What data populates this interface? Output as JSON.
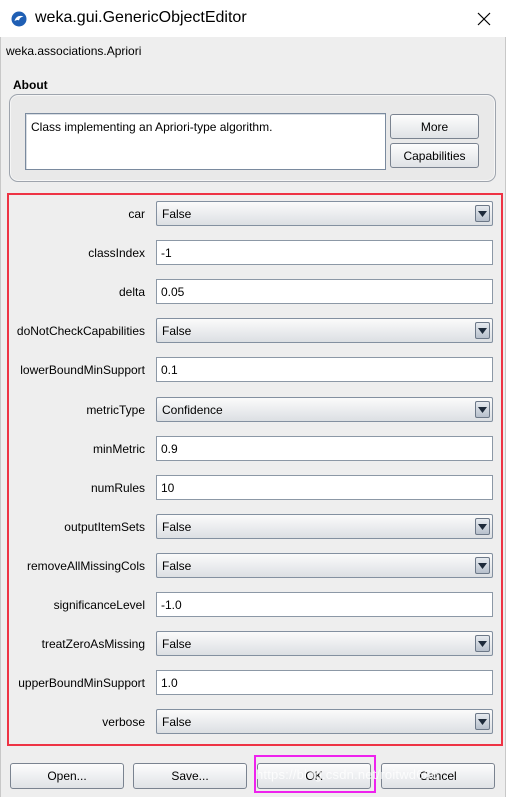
{
  "window": {
    "title": "weka.gui.GenericObjectEditor"
  },
  "editor": {
    "class_name": "weka.associations.Apriori"
  },
  "about": {
    "label": "About",
    "text": "Class implementing an Apriori-type algorithm.",
    "more_label": "More",
    "capabilities_label": "Capabilities"
  },
  "properties": [
    {
      "name": "car",
      "type": "combo",
      "value": "False"
    },
    {
      "name": "classIndex",
      "type": "text",
      "value": "-1"
    },
    {
      "name": "delta",
      "type": "text",
      "value": "0.05"
    },
    {
      "name": "doNotCheckCapabilities",
      "type": "combo",
      "value": "False"
    },
    {
      "name": "lowerBoundMinSupport",
      "type": "text",
      "value": "0.1"
    },
    {
      "name": "metricType",
      "type": "combo",
      "value": "Confidence"
    },
    {
      "name": "minMetric",
      "type": "text",
      "value": "0.9"
    },
    {
      "name": "numRules",
      "type": "text",
      "value": "10"
    },
    {
      "name": "outputItemSets",
      "type": "combo",
      "value": "False"
    },
    {
      "name": "removeAllMissingCols",
      "type": "combo",
      "value": "False"
    },
    {
      "name": "significanceLevel",
      "type": "text",
      "value": "-1.0"
    },
    {
      "name": "treatZeroAsMissing",
      "type": "combo",
      "value": "False"
    },
    {
      "name": "upperBoundMinSupport",
      "type": "text",
      "value": "1.0"
    },
    {
      "name": "verbose",
      "type": "combo",
      "value": "False"
    }
  ],
  "footer": {
    "open_label": "Open...",
    "save_label": "Save...",
    "ok_label": "OK",
    "cancel_label": "Cancel"
  },
  "watermark": "https://blog.csdn.net/roitwd666",
  "colors": {
    "properties_highlight": "#ee3344",
    "ok_highlight": "#ee22ee"
  }
}
